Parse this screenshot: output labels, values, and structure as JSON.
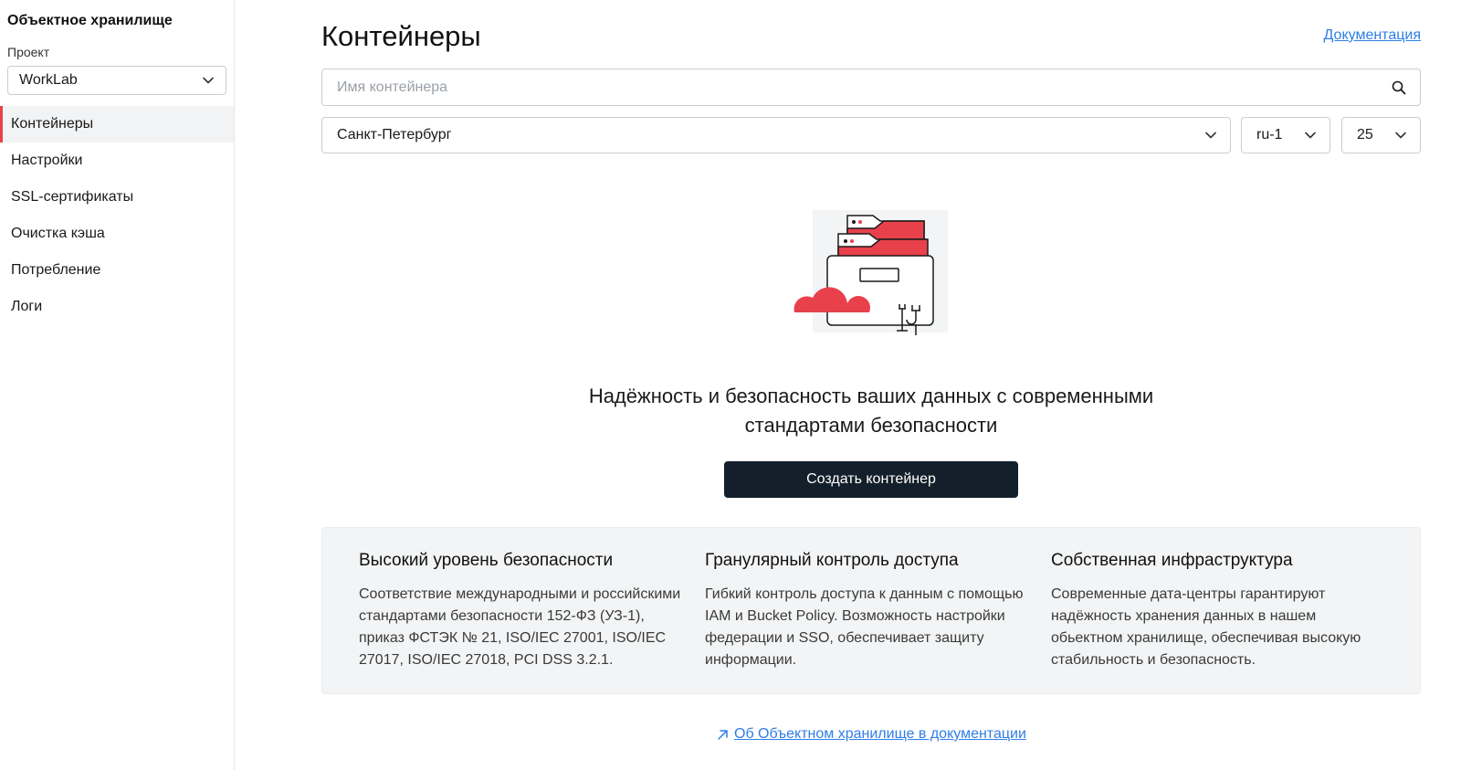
{
  "sidebar": {
    "title": "Объектное хранилище",
    "project_label": "Проект",
    "project_value": "WorkLab",
    "items": [
      {
        "label": "Контейнеры",
        "active": true
      },
      {
        "label": "Настройки"
      },
      {
        "label": "SSL-сертификаты"
      },
      {
        "label": "Очистка кэша"
      },
      {
        "label": "Потребление"
      },
      {
        "label": "Логи"
      }
    ]
  },
  "header": {
    "title": "Контейнеры",
    "doc_link": "Документация"
  },
  "search": {
    "placeholder": "Имя контейнера",
    "value": ""
  },
  "filters": {
    "region": "Санкт-Петербург",
    "zone": "ru-1",
    "page_size": "25"
  },
  "empty_state": {
    "line1": "Надёжность и безопасность ваших данных с современными",
    "line2": "стандартами безопасности",
    "create_button": "Создать контейнер"
  },
  "features": [
    {
      "title": "Высокий уровень безопасности",
      "text": "Соответствие международными и российскими стандартами безопасности 152-ФЗ (УЗ-1), приказ ФСТЭК № 21, ISO/IEC 27001, ISO/IEC 27017, ISO/IEC 27018, PCI DSS 3.2.1."
    },
    {
      "title": "Гранулярный контроль доступа",
      "text": "Гибкий контроль доступа к данным  с помощью IAM и Bucket Policy. Возможность настройки федерации и SSO, обеспечивает защиту информации."
    },
    {
      "title": "Собственная инфраструктура",
      "text": "Современные дата-центры гарантируют надёжность хранения данных в нашем обьектном хранилище, обеспечивая высокую стабильность и безопасность."
    }
  ],
  "footer_link": "Об Объектном хранилище в документации",
  "colors": {
    "accent_red": "#e8414b",
    "primary_button": "#13202b",
    "link_blue": "#2f7ee6"
  }
}
